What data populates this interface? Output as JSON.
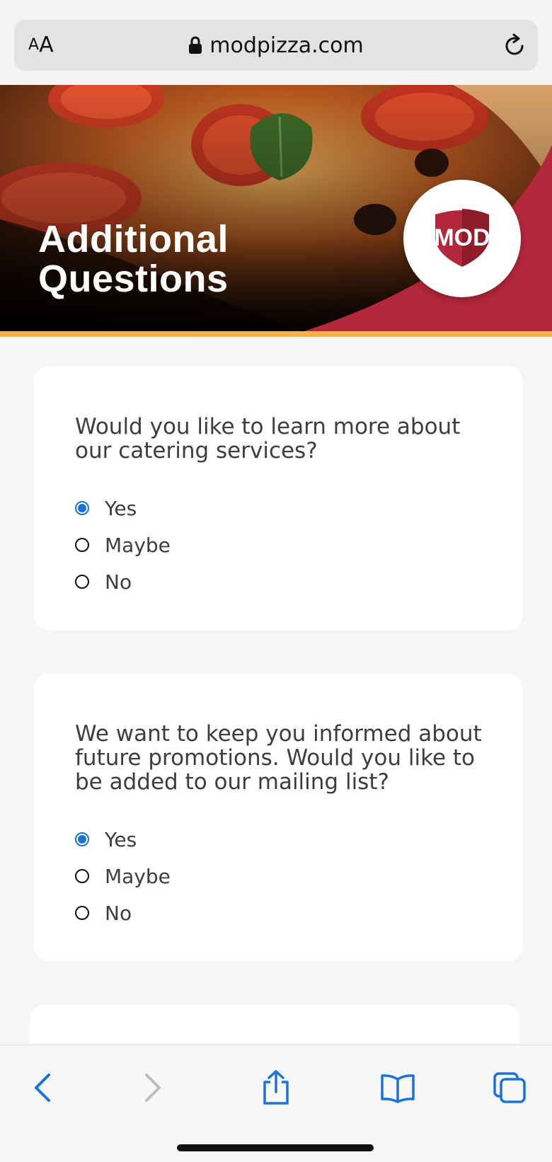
{
  "browser": {
    "aa_small": "A",
    "aa_big": "A",
    "url": "modpizza.com",
    "icons": [
      "lock-icon",
      "reload-icon"
    ]
  },
  "hero": {
    "title_line1": "Additional",
    "title_line2": "Questions",
    "logo_text": "MOD"
  },
  "questions": [
    {
      "text": "Would you like to learn more about our catering services?",
      "options": [
        "Yes",
        "Maybe",
        "No"
      ],
      "selected": "Yes"
    },
    {
      "text": "We want to keep you informed about future promotions. Would you like to be added to our mailing list?",
      "options": [
        "Yes",
        "Maybe",
        "No"
      ],
      "selected": "Yes"
    }
  ],
  "toolbar": {
    "icons": [
      "back-icon",
      "forward-icon",
      "share-icon",
      "bookmarks-icon",
      "tabs-icon"
    ]
  },
  "colors": {
    "accent_blue": "#1a73d9",
    "brand_red": "#b5273a",
    "gold": "#f2b44a"
  }
}
